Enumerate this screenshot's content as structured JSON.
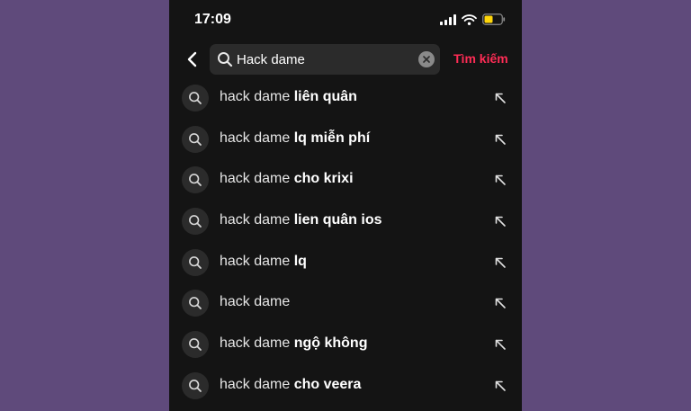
{
  "status_bar": {
    "time": "17:09"
  },
  "search": {
    "query": "Hack dame",
    "submit_label": "Tìm kiếm"
  },
  "suggestions": [
    {
      "prefix": "hack dame",
      "suffix": "liên quân"
    },
    {
      "prefix": "hack dame",
      "suffix": "lq miễn phí"
    },
    {
      "prefix": "hack dame",
      "suffix": "cho krixi"
    },
    {
      "prefix": "hack dame",
      "suffix": "lien quân ios"
    },
    {
      "prefix": "hack dame",
      "suffix": "lq"
    },
    {
      "prefix": "hack dame",
      "suffix": ""
    },
    {
      "prefix": "hack dame",
      "suffix": "ngộ không"
    },
    {
      "prefix": "hack dame",
      "suffix": "cho veera"
    }
  ],
  "colors": {
    "background": "#5f4a7b",
    "screen": "#141414",
    "accent": "#fe2c55",
    "search_field": "#2b2b2b",
    "battery": "#ffd60a"
  },
  "icons": {
    "back": "chevron-left-icon",
    "search": "search-icon",
    "clear": "clear-icon",
    "fill": "arrow-up-left-icon",
    "signal": "signal-icon",
    "wifi": "wifi-icon",
    "battery": "battery-icon"
  }
}
